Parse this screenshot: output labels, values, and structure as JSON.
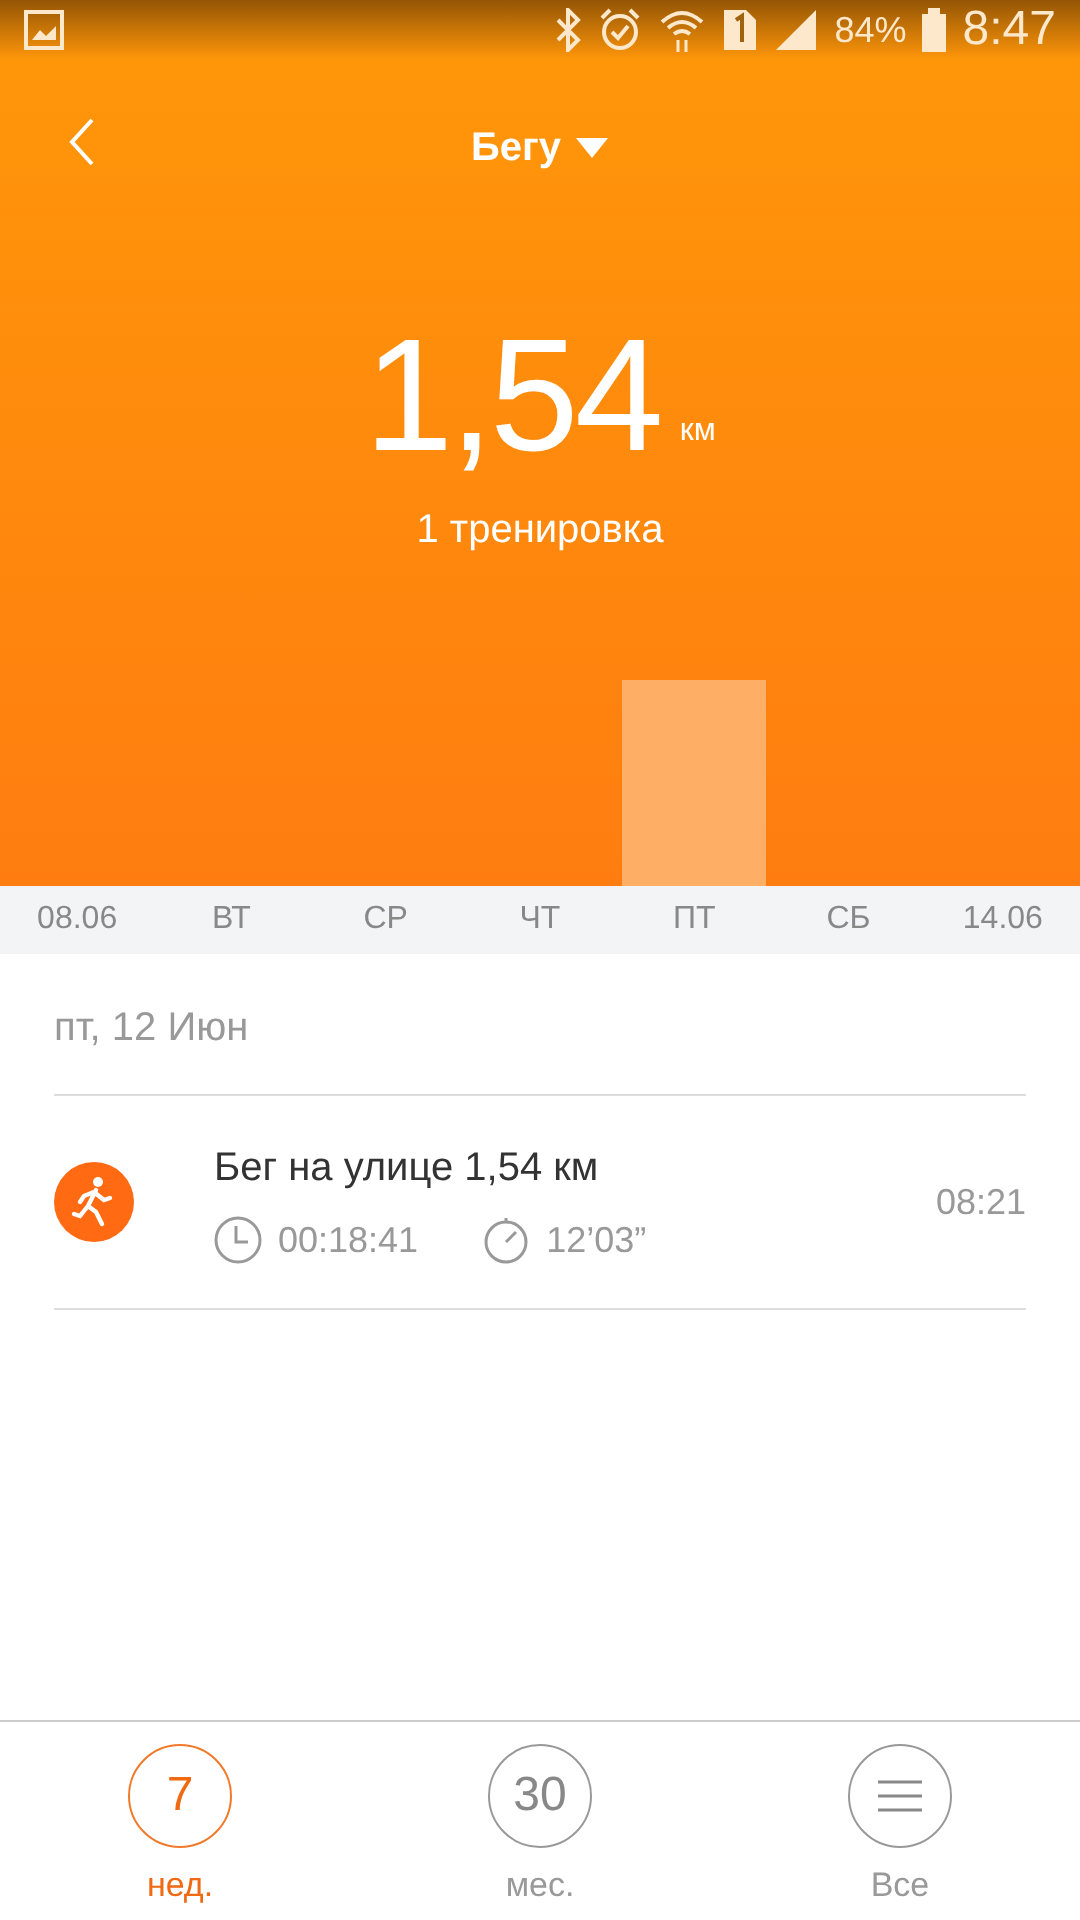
{
  "status_bar": {
    "battery": "84%",
    "time": "8:47"
  },
  "header": {
    "title": "Бегу"
  },
  "summary": {
    "value": "1,54",
    "unit": "км",
    "count": "1 тренировка"
  },
  "days": [
    {
      "label": "08.06",
      "selected": false
    },
    {
      "label": "ВТ",
      "selected": false
    },
    {
      "label": "СР",
      "selected": false
    },
    {
      "label": "ЧТ",
      "selected": false
    },
    {
      "label": "ПТ",
      "selected": true
    },
    {
      "label": "СБ",
      "selected": false
    },
    {
      "label": "14.06",
      "selected": false
    }
  ],
  "date_heading": "пт, 12 Июн",
  "workouts": [
    {
      "title": "Бег на улице",
      "distance": "1,54 км",
      "duration": "00:18:41",
      "pace": "12’03”",
      "time": "08:21"
    }
  ],
  "bottom_nav": [
    {
      "icon_text": "7",
      "label": "нед.",
      "selected": true
    },
    {
      "icon_text": "30",
      "label": "мес.",
      "selected": false
    },
    {
      "kind": "menu",
      "label": "Все",
      "selected": false
    }
  ]
}
